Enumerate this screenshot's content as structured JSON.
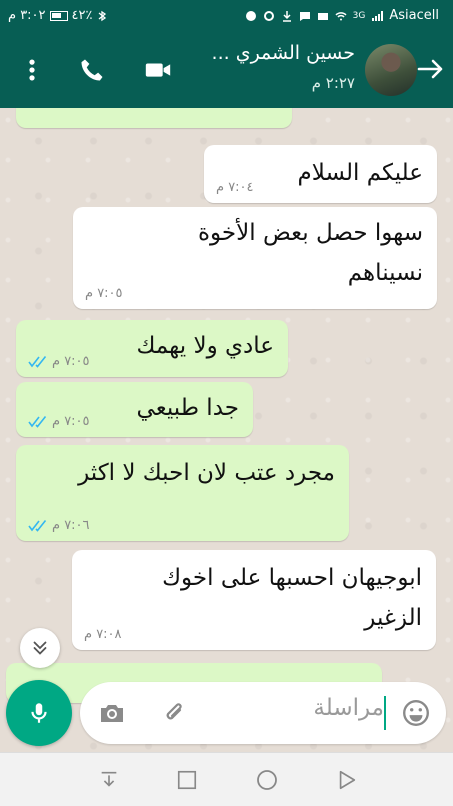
{
  "status_bar": {
    "carrier": "Asiacell",
    "network": "3G",
    "battery": "٤٢٪",
    "time": "٣:٠٢ م"
  },
  "header": {
    "contact_name": "حسين الشمري ...",
    "last_seen": "٢:٢٧ م"
  },
  "messages": [
    {
      "direction": "in",
      "text_lines": [
        "عليكم السلام"
      ],
      "time": "٧:٠٤ م"
    },
    {
      "direction": "in",
      "text_lines": [
        "سهوا حصل بعض الأخوة",
        "نسيناهم"
      ],
      "time": "٧:٠٥ م"
    },
    {
      "direction": "out",
      "text_lines": [
        "عادي ولا يهمك"
      ],
      "time": "٧:٠٥ م"
    },
    {
      "direction": "out",
      "text_lines": [
        "جدا طبيعي"
      ],
      "time": "٧:٠٥ م"
    },
    {
      "direction": "out",
      "text_lines": [
        "مجرد عتب لان احبك لا اكثر"
      ],
      "time": "٧:٠٦ م"
    },
    {
      "direction": "in",
      "text_lines": [
        "ابوجيهان احسبها على اخوك",
        "الزغير"
      ],
      "time": "٧:٠٨ م"
    }
  ],
  "composer": {
    "placeholder": "مراسلة"
  },
  "colors": {
    "header": "#075e54",
    "outgoing_bubble": "#dcf8c6",
    "incoming_bubble": "#ffffff",
    "accent": "#00a884",
    "read_ticks": "#34b7f1"
  },
  "icons": [
    "back-arrow-icon",
    "phone-icon",
    "video-camera-icon",
    "more-vert-icon",
    "microphone-icon",
    "camera-icon",
    "attachment-icon",
    "emoji-icon",
    "chevrons-down-icon",
    "double-check-icon"
  ]
}
